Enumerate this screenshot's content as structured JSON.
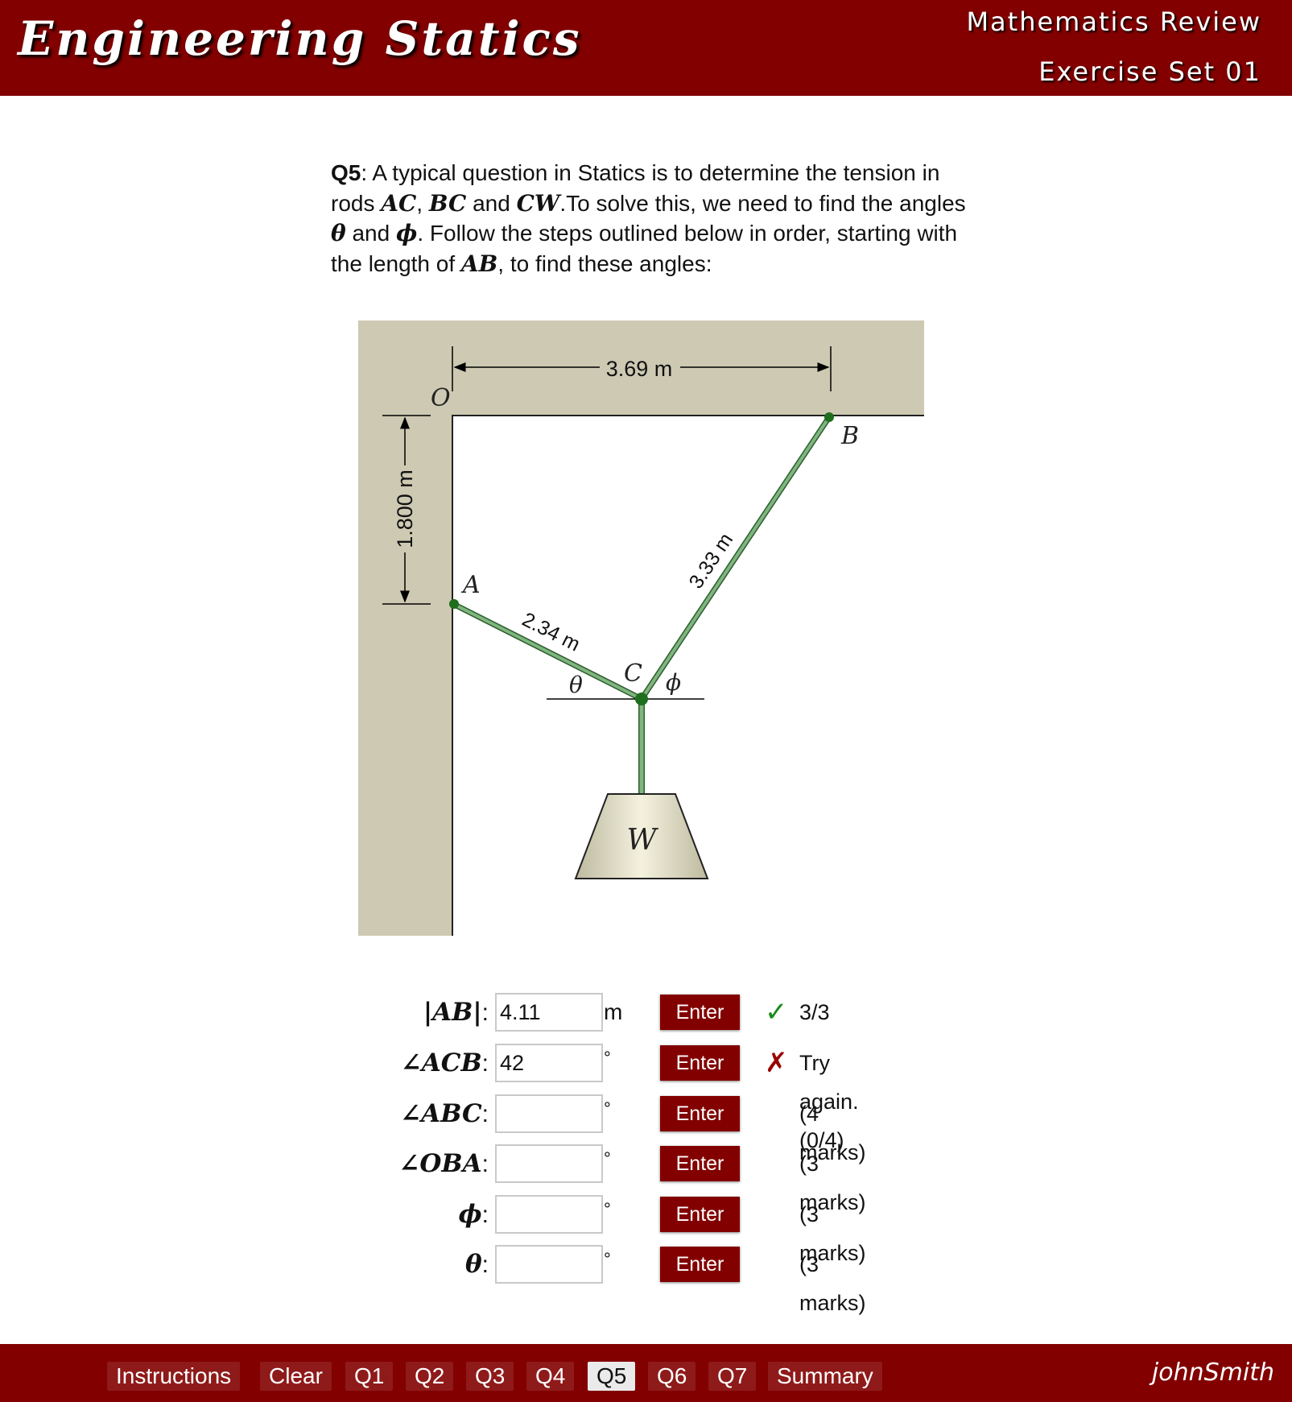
{
  "header": {
    "title": "Engineering Statics",
    "subtitle": "Mathematics Review",
    "set": "Exercise Set 01"
  },
  "question": {
    "number": "Q5",
    "t1": ": A typical question in Statics is to determine the tension in rods ",
    "AC": "AC",
    "comma": ", ",
    "BC": "BC",
    "and1": " and ",
    "CW": "CW",
    "t2": ".To solve this, we need to find the angles ",
    "theta": "θ",
    "and2": " and ",
    "phi": "ϕ",
    "t3": ". Follow the steps outlined below in order, starting with the length of ",
    "AB": "AB",
    "t4": ", to find these angles:"
  },
  "figure": {
    "dim_horizontal": "3.69 m",
    "dim_vertical": "1.800 m",
    "len_AC": "2.34 m",
    "len_BC": "3.33 m",
    "pt_O": "O",
    "pt_A": "A",
    "pt_B": "B",
    "pt_C": "C",
    "pt_W": "W",
    "ang_theta": "θ",
    "ang_phi": "ϕ",
    "colors": {
      "wall": "#cdc9b2",
      "rod": "#5e955e",
      "pin": "#1e6e1e"
    }
  },
  "answers": [
    {
      "label": "|AB|",
      "value": "4.11",
      "unit": "m",
      "button": "Enter",
      "status_icon": "✓",
      "status": "3/3"
    },
    {
      "label": "∠ACB",
      "value": "42",
      "unit": "°",
      "button": "Enter",
      "status_icon": "✗",
      "status": "Try again. (0/4)"
    },
    {
      "label": "∠ABC",
      "value": "",
      "unit": "°",
      "button": "Enter",
      "status_icon": "",
      "status": "(4 marks)"
    },
    {
      "label": "∠OBA",
      "value": "",
      "unit": "°",
      "button": "Enter",
      "status_icon": "",
      "status": "(3 marks)"
    },
    {
      "label": "ϕ",
      "value": "",
      "unit": "°",
      "button": "Enter",
      "status_icon": "",
      "status": "(3 marks)"
    },
    {
      "label": "θ",
      "value": "",
      "unit": "°",
      "button": "Enter",
      "status_icon": "",
      "status": "(3 marks)"
    }
  ],
  "answer_colon": ":",
  "footer": {
    "nav": [
      "Instructions",
      "Clear",
      "Q1",
      "Q2",
      "Q3",
      "Q4",
      "Q5",
      "Q6",
      "Q7",
      "Summary"
    ],
    "active": "Q5",
    "user": "johnSmith"
  },
  "colors": {
    "brand": "#820000",
    "correct": "#1a8a1a",
    "wrong": "#990000"
  }
}
